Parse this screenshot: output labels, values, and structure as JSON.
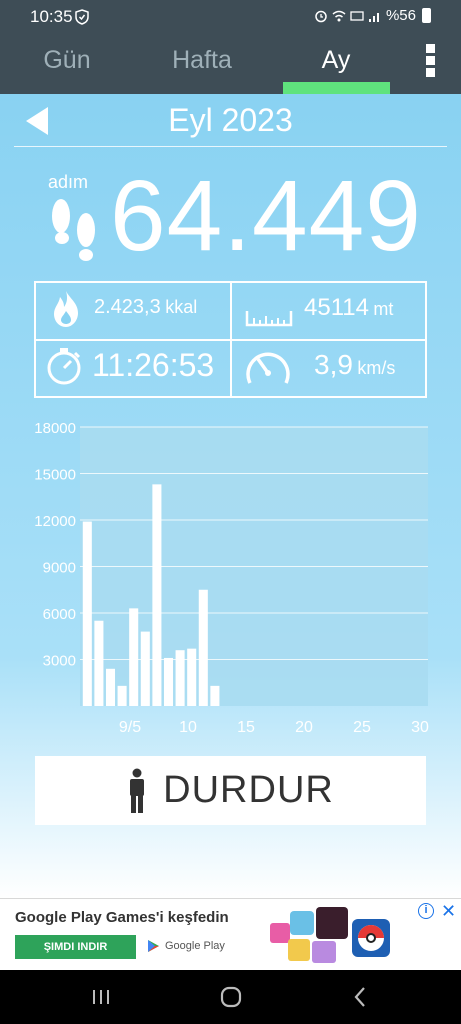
{
  "status_bar": {
    "time": "10:35",
    "battery": "%56",
    "icons": [
      "shield-icon",
      "alarm-icon",
      "wifi-icon",
      "volte-icon",
      "signal-icon",
      "battery-icon"
    ]
  },
  "tabs": [
    {
      "label": "Gün",
      "active": false
    },
    {
      "label": "Hafta",
      "active": false
    },
    {
      "label": "Ay",
      "active": true
    }
  ],
  "header": {
    "title": "Eyl 2023"
  },
  "steps": {
    "label": "adım",
    "value": "64.449"
  },
  "stats": {
    "calories": {
      "value": "2.423,3",
      "unit": "kkal"
    },
    "distance": {
      "value": "45114",
      "unit": "mt"
    },
    "time": {
      "value": "11:26:53"
    },
    "speed": {
      "value": "3,9",
      "unit": "km/s"
    }
  },
  "chart_data": {
    "type": "bar",
    "x": [
      1,
      2,
      3,
      4,
      5,
      6,
      7,
      8,
      9,
      10,
      11,
      12
    ],
    "values": [
      11900,
      5500,
      2400,
      1300,
      6300,
      4800,
      14300,
      3100,
      3600,
      3700,
      7500,
      1300
    ],
    "xlim": [
      0,
      30
    ],
    "ylim": [
      0,
      18000
    ],
    "yticks": [
      "3000",
      "6000",
      "9000",
      "12000",
      "15000",
      "18000"
    ],
    "xticks": [
      {
        "value": 5,
        "label": "9/5"
      },
      {
        "value": 10,
        "label": "10"
      },
      {
        "value": 15,
        "label": "15"
      },
      {
        "value": 20,
        "label": "20"
      },
      {
        "value": 25,
        "label": "25"
      },
      {
        "value": 30,
        "label": "30"
      }
    ],
    "grid": true,
    "bar_color": "#ffffff"
  },
  "stop_button": {
    "label": "DURDUR"
  },
  "ad": {
    "title": "Google Play Games'i keşfedin",
    "cta": "ŞIMDI INDIR",
    "store": "Google Play"
  },
  "colors": {
    "toolbar": "#3e4d56",
    "accent": "#5fe37d",
    "background": "#89d2f2"
  }
}
